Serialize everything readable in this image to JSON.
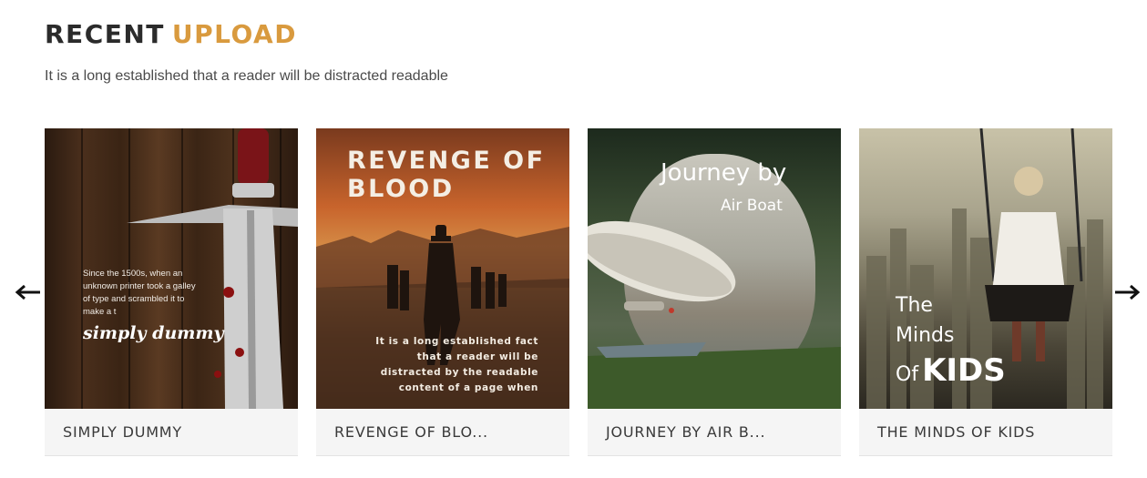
{
  "section": {
    "title_part1": "RECENT",
    "title_part2": "UPLOAD",
    "subtitle": "It is a long established that a reader will be distracted readable"
  },
  "carousel": {
    "prev_icon": "arrow-left-icon",
    "next_icon": "arrow-right-icon",
    "items": [
      {
        "caption": "SIMPLY DUMMY",
        "cover_text": "Since the 1500s, when an unknown printer took a galley of type and scrambled it to make a t",
        "cover_big": "simply dummy"
      },
      {
        "caption": "REVENGE OF BLO...",
        "cover_title_line1": "REVENGE OF",
        "cover_title_line2": "BLOOD",
        "cover_text": "It is a long established fact that a reader will be distracted by the readable content of a page when"
      },
      {
        "caption": "JOURNEY BY AIR B...",
        "cover_title": "Journey by",
        "cover_subtitle": "Air Boat"
      },
      {
        "caption": "THE MINDS OF KIDS",
        "cover_line1": "The",
        "cover_line2": "Minds",
        "cover_line3_a": "Of",
        "cover_line3_b": "KIDS"
      }
    ]
  },
  "colors": {
    "accent": "#d99a3e",
    "heading": "#2b2b2b",
    "caption_bg": "#f5f5f5"
  }
}
